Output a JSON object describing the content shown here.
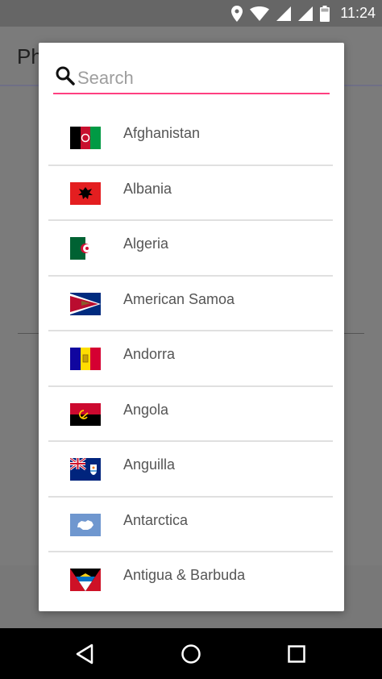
{
  "status_bar": {
    "time": "11:24",
    "icons": [
      "location-icon",
      "wifi-icon",
      "signal-icon",
      "signal-icon",
      "battery-icon"
    ]
  },
  "background_app": {
    "title_fragment": "Ph"
  },
  "dialog": {
    "search_placeholder": "Search",
    "search_value": "",
    "accent_color": "#ff4081",
    "countries": [
      {
        "name": "Afghanistan"
      },
      {
        "name": "Albania"
      },
      {
        "name": "Algeria"
      },
      {
        "name": "American Samoa"
      },
      {
        "name": "Andorra"
      },
      {
        "name": "Angola"
      },
      {
        "name": "Anguilla"
      },
      {
        "name": "Antarctica"
      },
      {
        "name": "Antigua & Barbuda"
      }
    ]
  },
  "nav_bar": {
    "buttons": [
      "back-icon",
      "home-icon",
      "recents-icon"
    ]
  }
}
